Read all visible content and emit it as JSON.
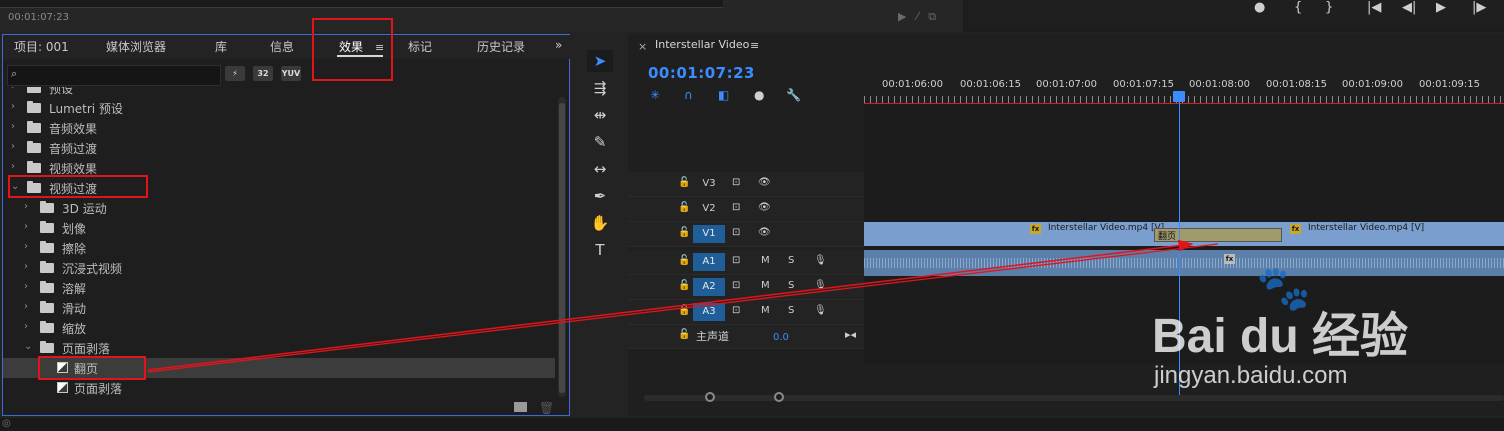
{
  "source_monitor": {
    "timecode": "00:01:07:23",
    "icons": [
      "marker-in-icon",
      "insert-icon"
    ]
  },
  "program_monitor": {
    "controls": [
      "marker-icon",
      "mark-in-icon",
      "mark-out-icon",
      "go-to-in-icon",
      "step-back-icon",
      "play-icon",
      "step-forward-icon"
    ],
    "glyphs": [
      "●",
      "{",
      "}",
      "|◀",
      "◀|",
      "▶",
      "|▶"
    ]
  },
  "effects_panel": {
    "tabs": [
      "项目: 001",
      "媒体浏览器",
      "库",
      "信息",
      "效果",
      "标记",
      "历史记录"
    ],
    "active_tab": "效果",
    "overflow": "»",
    "search_placeholder": "",
    "filter_buttons": [
      "32",
      "YUV"
    ],
    "tree": [
      {
        "label": "预设",
        "indent": 0,
        "type": "folder"
      },
      {
        "label": "Lumetri 预设",
        "indent": 0,
        "type": "folder"
      },
      {
        "label": "音频效果",
        "indent": 0,
        "type": "folder"
      },
      {
        "label": "音频过渡",
        "indent": 0,
        "type": "folder"
      },
      {
        "label": "视频效果",
        "indent": 0,
        "type": "folder"
      },
      {
        "label": "视频过渡",
        "indent": 0,
        "type": "folder",
        "expanded": true
      },
      {
        "label": "3D 运动",
        "indent": 1,
        "type": "folder"
      },
      {
        "label": "划像",
        "indent": 1,
        "type": "folder"
      },
      {
        "label": "擦除",
        "indent": 1,
        "type": "folder"
      },
      {
        "label": "沉浸式视频",
        "indent": 1,
        "type": "folder"
      },
      {
        "label": "溶解",
        "indent": 1,
        "type": "folder"
      },
      {
        "label": "滑动",
        "indent": 1,
        "type": "folder"
      },
      {
        "label": "缩放",
        "indent": 1,
        "type": "folder"
      },
      {
        "label": "页面剥落",
        "indent": 1,
        "type": "folder",
        "expanded": true
      },
      {
        "label": "翻页",
        "indent": 2,
        "type": "effect",
        "selected": true
      },
      {
        "label": "页面剥落",
        "indent": 2,
        "type": "effect"
      }
    ]
  },
  "tools": [
    "selection-tool",
    "track-select-tool",
    "ripple-edit-tool",
    "razor-tool",
    "slip-tool",
    "pen-tool",
    "hand-tool",
    "type-tool"
  ],
  "timeline": {
    "sequence_name": "Interstellar Video",
    "timecode": "00:01:07:23",
    "ruler_labels": [
      "00:01:06:00",
      "00:01:06:15",
      "00:01:07:00",
      "00:01:07:15",
      "00:01:08:00",
      "00:01:08:15",
      "00:01:09:00",
      "00:01:09:15"
    ],
    "tracks": [
      {
        "name": "V3",
        "kind": "video",
        "active": false
      },
      {
        "name": "V2",
        "kind": "video",
        "active": false
      },
      {
        "name": "V1",
        "kind": "video",
        "active": true
      },
      {
        "name": "A1",
        "kind": "audio",
        "active": true
      },
      {
        "name": "A2",
        "kind": "audio",
        "active": true
      },
      {
        "name": "A3",
        "kind": "audio",
        "active": true
      }
    ],
    "audio_buttons": {
      "mute": "M",
      "solo": "S"
    },
    "master": {
      "label": "主声道",
      "volume": "0.0"
    },
    "clips": {
      "clip_a": "Interstellar Video.mp4 [V]",
      "clip_b": "Interstellar Video.mp4 [V]",
      "transition": "翻页",
      "fx_badge": "fx"
    }
  },
  "watermark": {
    "brand": "Bai  du 经验",
    "url": "jingyan.baidu.com"
  },
  "annotation_color": "#e2141b"
}
